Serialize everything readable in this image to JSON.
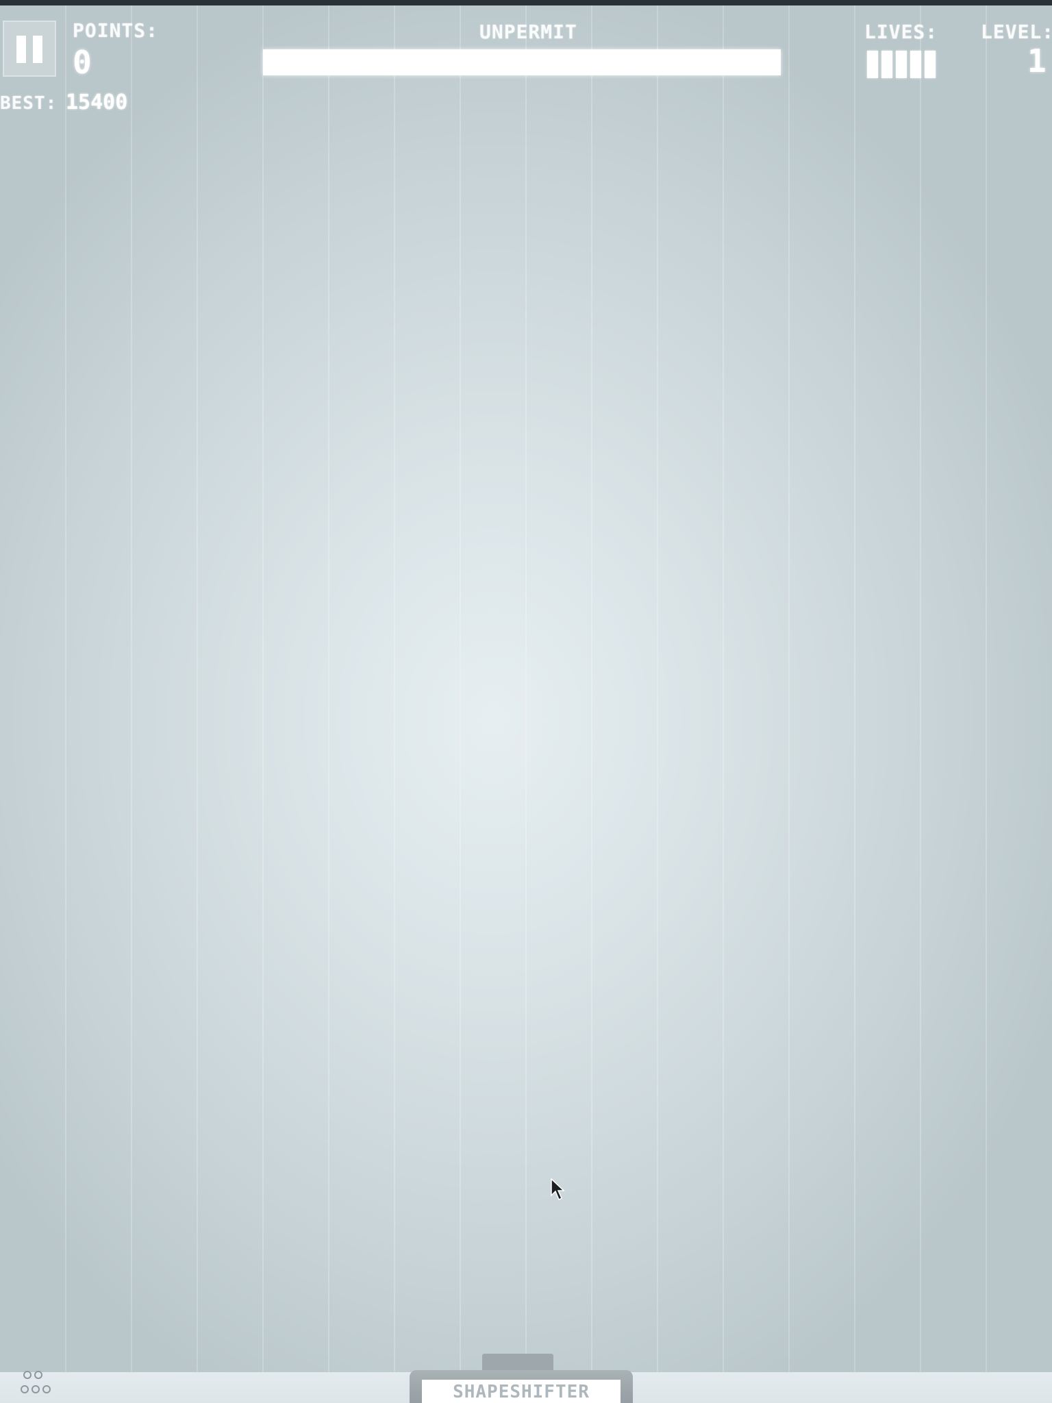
{
  "hud": {
    "points_label": "POINTS:",
    "points_value": "0",
    "best_label": "BEST:",
    "best_value": "15400",
    "title": "UNPERMIT",
    "progress_fraction": 1.0,
    "lives_label": "LIVES:",
    "lives_count": 5,
    "level_label": "LEVEL:",
    "level_value": "1"
  },
  "launcher": {
    "label": "SHAPESHIFTER"
  },
  "icons": {
    "pause": "pause-icon",
    "cursor": "mouse-cursor-icon",
    "players": "players-icon"
  },
  "colors": {
    "background": "#d9e3e6",
    "hud_text": "#ffffff",
    "launcher": "#9ea8ac"
  }
}
